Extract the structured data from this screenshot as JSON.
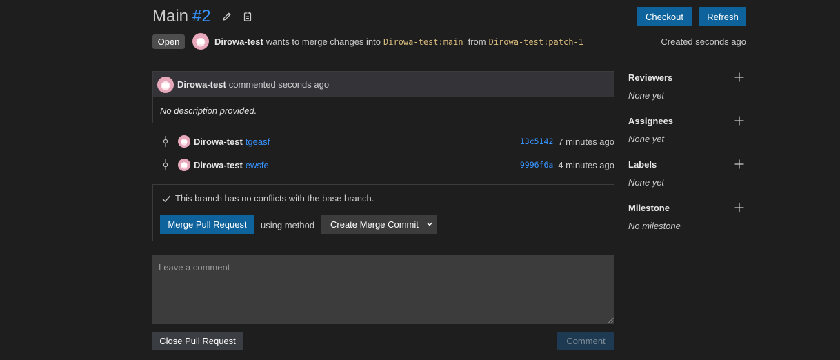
{
  "header": {
    "title": "Main",
    "number": "#2",
    "checkout_label": "Checkout",
    "refresh_label": "Refresh",
    "status": "Open",
    "author": "Dirowa-test",
    "wants_text": "wants to merge changes into",
    "target_branch": "Dirowa-test:main",
    "from_text": "from",
    "source_branch": "Dirowa-test:patch-1",
    "created": "Created seconds ago"
  },
  "comment": {
    "author": "Dirowa-test",
    "meta": "commented seconds ago",
    "body": "No description provided."
  },
  "commits": [
    {
      "author": "Dirowa-test",
      "message": "tgeasf",
      "sha": "13c5142",
      "time": "7 minutes ago"
    },
    {
      "author": "Dirowa-test",
      "message": "ewsfe",
      "sha": "9996f6a",
      "time": "4 minutes ago"
    }
  ],
  "merge": {
    "status": "This branch has no conflicts with the base branch.",
    "button_label": "Merge Pull Request",
    "using_method": "using method",
    "method_value": "Create Merge Commit"
  },
  "new_comment": {
    "placeholder": "Leave a comment",
    "close_label": "Close Pull Request",
    "comment_label": "Comment"
  },
  "sidebar": {
    "reviewers": {
      "title": "Reviewers",
      "value": "None yet"
    },
    "assignees": {
      "title": "Assignees",
      "value": "None yet"
    },
    "labels": {
      "title": "Labels",
      "value": "None yet"
    },
    "milestone": {
      "title": "Milestone",
      "value": "No milestone"
    }
  },
  "colors": {
    "background": "#1e1e1e",
    "primary_button": "#0e639c",
    "link": "#3794ff",
    "branch": "#d7ba7d"
  }
}
